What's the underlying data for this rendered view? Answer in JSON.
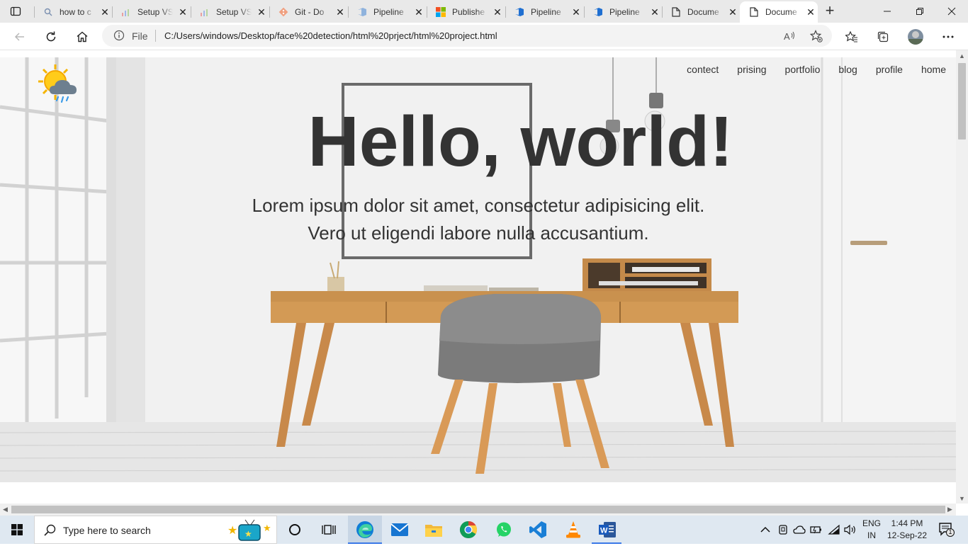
{
  "browser": {
    "tabs": [
      {
        "title": "how to c",
        "icon": "search-icon"
      },
      {
        "title": "Setup VS",
        "icon": "chart-icon"
      },
      {
        "title": "Setup VS",
        "icon": "chart-icon"
      },
      {
        "title": "Git - Do",
        "icon": "git-icon"
      },
      {
        "title": "Pipeline",
        "icon": "azure-devops-icon"
      },
      {
        "title": "Publishe",
        "icon": "microsoft-icon"
      },
      {
        "title": "Pipeline",
        "icon": "azure-devops-icon"
      },
      {
        "title": "Pipeline",
        "icon": "azure-devops-icon"
      },
      {
        "title": "Docume",
        "icon": "document-icon"
      },
      {
        "title": "Docume",
        "icon": "document-icon",
        "active": true
      }
    ],
    "file_label": "File",
    "url": "C:/Users/windows/Desktop/face%20detection/html%20prject/html%20project.html"
  },
  "page": {
    "nav": [
      "contect",
      "prising",
      "portfolio",
      "blog",
      "profile",
      "home"
    ],
    "hero_title": "Hello, world!",
    "hero_line1": "Lorem ipsum dolor sit amet, consectetur adipisicing elit.",
    "hero_line2": "Vero ut eligendi labore nulla accusantium."
  },
  "taskbar": {
    "search_placeholder": "Type here to search",
    "apps": [
      "task-view-icon",
      "edge-icon",
      "mail-icon",
      "file-explorer-icon",
      "chrome-icon",
      "whatsapp-icon",
      "vscode-icon",
      "vlc-icon",
      "word-icon"
    ],
    "lang_line1": "ENG",
    "lang_line2": "IN",
    "time": "1:44 PM",
    "date": "12-Sep-22",
    "notification_count": "1"
  },
  "colors": {
    "accent": "#3b78e7",
    "tab_strip": "#e9e9e9",
    "taskbar": "#dfe8f1",
    "text_dark": "#333333"
  }
}
